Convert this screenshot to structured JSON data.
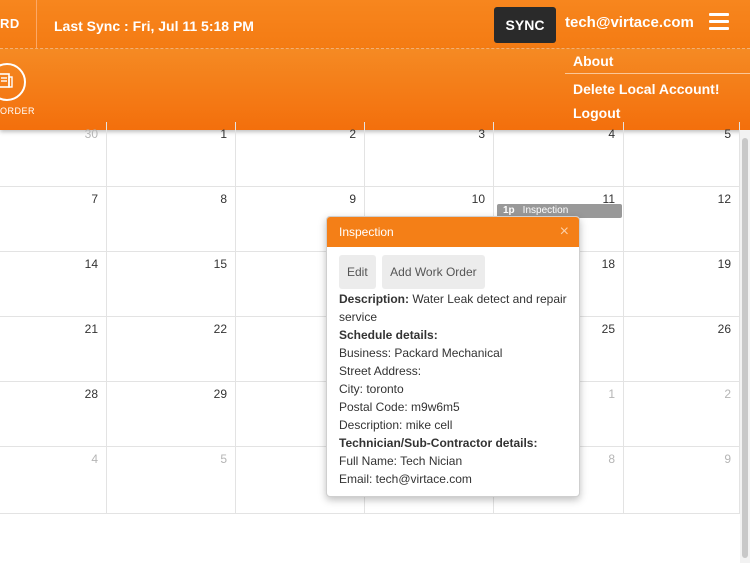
{
  "header": {
    "left_stub_label": "RD",
    "last_sync": "Last Sync : Fri, Jul 11 5:18 PM",
    "sync_label": "SYNC",
    "user_email": "tech@virtace.com"
  },
  "toolbar": {
    "workorder_label": "ORDER"
  },
  "menu": {
    "items": [
      "About",
      "Delete Local Account!",
      "Logout"
    ]
  },
  "calendar": {
    "rows": [
      [
        {
          "d": "30",
          "muted": true
        },
        {
          "d": "1"
        },
        {
          "d": "2"
        },
        {
          "d": "3"
        },
        {
          "d": "4"
        },
        {
          "d": "5"
        }
      ],
      [
        {
          "d": "7"
        },
        {
          "d": "8"
        },
        {
          "d": "9"
        },
        {
          "d": "10"
        },
        {
          "d": "11"
        },
        {
          "d": "12"
        }
      ],
      [
        {
          "d": "14"
        },
        {
          "d": "15"
        },
        {
          "d": ""
        },
        {
          "d": ""
        },
        {
          "d": "18"
        },
        {
          "d": "19"
        }
      ],
      [
        {
          "d": "21"
        },
        {
          "d": "22"
        },
        {
          "d": ""
        },
        {
          "d": ""
        },
        {
          "d": "25"
        },
        {
          "d": "26"
        }
      ],
      [
        {
          "d": "28"
        },
        {
          "d": "29"
        },
        {
          "d": ""
        },
        {
          "d": ""
        },
        {
          "d": "1",
          "muted": true
        },
        {
          "d": "2",
          "muted": true
        }
      ],
      [
        {
          "d": "4",
          "muted": true
        },
        {
          "d": "5",
          "muted": true
        },
        {
          "d": ""
        },
        {
          "d": ""
        },
        {
          "d": "8",
          "muted": true
        },
        {
          "d": "9",
          "muted": true
        }
      ]
    ],
    "event": {
      "time": "1p",
      "title": "Inspection"
    }
  },
  "popover": {
    "title": "Inspection",
    "close_glyph": "×",
    "edit_label": "Edit",
    "add_work_order_label": "Add Work Order",
    "description_label": "Description:",
    "description_value": "Water Leak detect and repair service",
    "schedule_heading": "Schedule details:",
    "business": "Business: Packard Mechanical",
    "street": "Street Address:",
    "city": "City: toronto",
    "postal": "Postal Code: m9w6m5",
    "schedule_description": "Description: mike cell",
    "technician_heading": "Technician/Sub-Contractor details:",
    "full_name": "Full Name: Tech Nician",
    "email": "Email: tech@virtace.com"
  }
}
